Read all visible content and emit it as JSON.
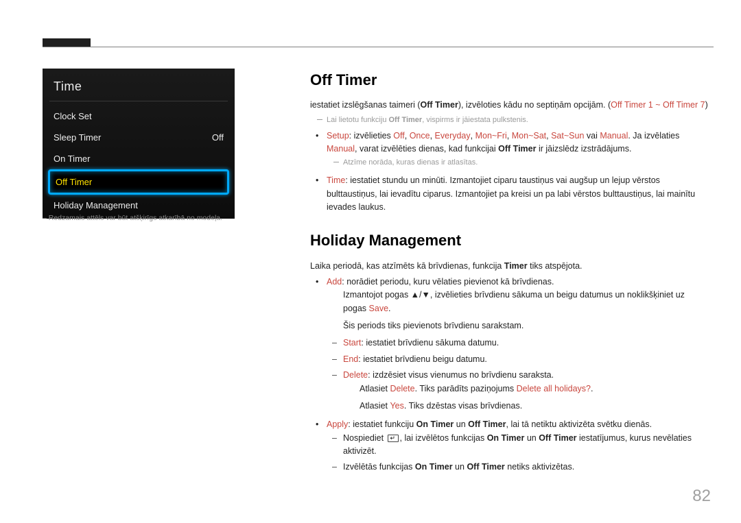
{
  "osd": {
    "title": "Time",
    "items": {
      "clock_set": "Clock Set",
      "sleep_timer": "Sleep Timer",
      "sleep_timer_val": "Off",
      "on_timer": "On Timer",
      "off_timer": "Off Timer",
      "holiday_mgmt": "Holiday Management"
    }
  },
  "caption": "– Redzamais attēls var būt atšķirīgs atkarībā no modeļa.",
  "h": {
    "off_timer": "Off Timer",
    "holiday": "Holiday Management"
  },
  "off_timer": {
    "intro_pre": "iestatiet izslēgšanas taimeri (",
    "intro_b1": "Off Timer",
    "intro_mid": "), izvēloties kādu no septiņām opcijām. (",
    "intro_b2": "Off Timer 1 ~ Off Timer 7",
    "intro_post": ")",
    "note_pre": "Lai lietotu funkciju ",
    "note_b": "Off Timer",
    "note_post": ", vispirms ir jāiestata pulkstenis.",
    "setup_label": "Setup",
    "setup_1": ": izvēlieties ",
    "setup_opts": [
      "Off",
      "Once",
      "Everyday",
      "Mon~Fri",
      "Mon~Sat",
      "Sat~Sun",
      "Manual"
    ],
    "setup_or": " vai ",
    "setup_2": ". Ja izvēlaties ",
    "setup_manual": "Manual",
    "setup_3": ", varat izvēlēties dienas, kad funkcijai ",
    "setup_b": "Off Timer",
    "setup_4": " ir jāizslēdz izstrādājums.",
    "setup_note": "Atzīme norāda, kuras dienas ir atlasītas.",
    "time_label": "Time",
    "time_text": ": iestatiet stundu un minūti. Izmantojiet ciparu taustiņus vai augšup un lejup vērstos bulttaustiņus, lai ievadītu ciparus. Izmantojiet pa kreisi un pa labi vērstos bulttaustiņus, lai mainītu ievades laukus."
  },
  "holiday": {
    "intro_pre": "Laika periodā, kas atzīmēts kā brīvdienas, funkcija ",
    "intro_b": "Timer",
    "intro_post": " tiks atspējota.",
    "add_label": "Add",
    "add_text": ": norādiet periodu, kuru vēlaties pievienot kā brīvdienas.",
    "add_line2_pre": "Izmantojot pogas ▲/▼, izvēlieties brīvdienu sākuma un beigu datumus un noklikšķiniet uz pogas ",
    "add_line2_b": "Save",
    "add_line2_post": ".",
    "add_line3": "Šis periods tiks pievienots brīvdienu sarakstam.",
    "start_label": "Start",
    "start_text": ": iestatiet brīvdienu sākuma datumu.",
    "end_label": "End",
    "end_text": ": iestatiet brīvdienu beigu datumu.",
    "delete_label": "Delete",
    "delete_text": ": izdzēsiet visus vienumus no brīvdienu saraksta.",
    "delete2_pre": "Atlasiet ",
    "delete2_b1": "Delete",
    "delete2_mid": ". Tiks parādīts paziņojums ",
    "delete2_b2": "Delete all holidays?",
    "delete2_post": ".",
    "delete3_pre": "Atlasiet ",
    "delete3_b": "Yes",
    "delete3_post": ". Tiks dzēstas visas brīvdienas.",
    "apply_label": "Apply",
    "apply_1": ": iestatiet funkciju ",
    "apply_b1": "On Timer",
    "apply_and": " un ",
    "apply_b2": "Off Timer",
    "apply_2": ", lai tā netiktu aktivizēta svētku dienās.",
    "apply_d1_pre": "Nospiediet ",
    "apply_d1_mid": ", lai izvēlētos funkcijas ",
    "apply_d1_post": " iestatījumus, kurus nevēlaties aktivizēt.",
    "apply_d2_pre": "Izvēlētās funkcijas ",
    "apply_d2_post": " netiks aktivizētas."
  },
  "page_number": "82"
}
